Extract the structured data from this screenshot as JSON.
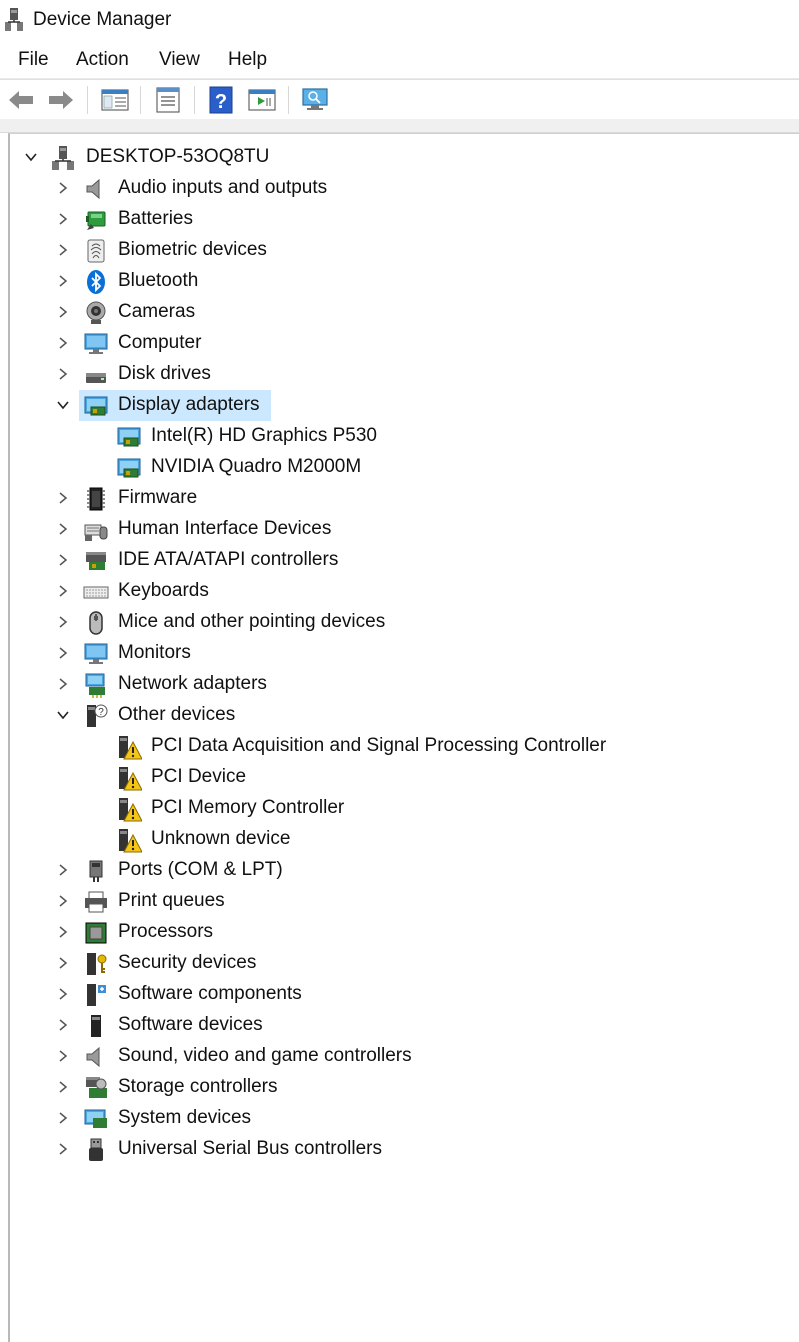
{
  "window": {
    "title": "Device Manager"
  },
  "menu": [
    "File",
    "Action",
    "View",
    "Help"
  ],
  "toolbar": {
    "buttons": [
      "back-arrow-icon",
      "forward-arrow-icon",
      "show-hide-console-tree-icon",
      "properties-icon",
      "help-icon",
      "update-driver-icon",
      "scan-hardware-changes-icon"
    ]
  },
  "tree": {
    "root": "DESKTOP-53OQ8TU",
    "categories": [
      "Audio inputs and outputs",
      "Batteries",
      "Biometric devices",
      "Bluetooth",
      "Cameras",
      "Computer",
      "Disk drives",
      "Display adapters",
      "Firmware",
      "Human Interface Devices",
      "IDE ATA/ATAPI controllers",
      "Keyboards",
      "Mice and other pointing devices",
      "Monitors",
      "Network adapters",
      "Other devices",
      "Ports (COM & LPT)",
      "Print queues",
      "Processors",
      "Security devices",
      "Software components",
      "Software devices",
      "Sound, video and game controllers",
      "Storage controllers",
      "System devices",
      "Universal Serial Bus controllers"
    ],
    "display_children": [
      "Intel(R) HD Graphics P530",
      "NVIDIA Quadro M2000M"
    ],
    "other_children": [
      "PCI Data Acquisition and Signal Processing Controller",
      "PCI Device",
      "PCI Memory Controller",
      "Unknown device"
    ],
    "selected": "Display adapters"
  },
  "colors": {
    "selection": "#cce8ff",
    "accent": "#0078d7",
    "warning": "#f5c518"
  }
}
